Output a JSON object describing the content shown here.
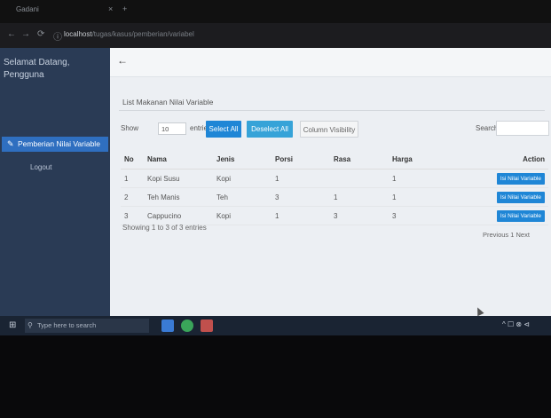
{
  "browser": {
    "tab_title": "Gadani",
    "tab_close": "×",
    "tab_new": "+",
    "url_host": "localhost",
    "url_path": "/tugas/kasus/pemberian/variabel"
  },
  "sidebar": {
    "brand": "Selamat Datang, Pengguna",
    "items": [
      {
        "label": "Pemberian Nilai Variable",
        "icon": "pencil-icon"
      },
      {
        "label": "Logout"
      }
    ]
  },
  "main": {
    "back_icon": "←",
    "card_title": "List Makanan Nilai Variable",
    "controls": {
      "show_label": "Show",
      "entries_value": "10",
      "entries_label": "entries",
      "select_all": "Select All",
      "deselect_all": "Deselect All",
      "column_visibility": "Column Visibility",
      "search_label": "Search:"
    },
    "table": {
      "headers": [
        "No",
        "Nama",
        "Jenis",
        "Porsi",
        "Rasa",
        "Harga",
        "Action"
      ],
      "rows": [
        {
          "no": "1",
          "nama": "Kopi Susu",
          "jenis": "Kopi",
          "porsi": "1",
          "rasa": "",
          "harga": "1",
          "action": "Isi Nilai Variable"
        },
        {
          "no": "2",
          "nama": "Teh Manis",
          "jenis": "Teh",
          "porsi": "3",
          "rasa": "1",
          "harga": "1",
          "action": "Isi Nilai Variable"
        },
        {
          "no": "3",
          "nama": "Cappucino",
          "jenis": "Kopi",
          "porsi": "1",
          "rasa": "3",
          "harga": "3",
          "action": "Isi Nilai Variable"
        }
      ]
    },
    "info": "Showing 1 to 3 of 3 entries",
    "pager": "Previous 1 Next"
  },
  "taskbar": {
    "search_placeholder": "Type here to search",
    "tray": "^ ☐ ⊗ ⊲"
  },
  "colors": {
    "primary_button": "#1f86d6",
    "sidebar_bg": "#2a3b55",
    "sidebar_active": "#2f6fc0"
  }
}
